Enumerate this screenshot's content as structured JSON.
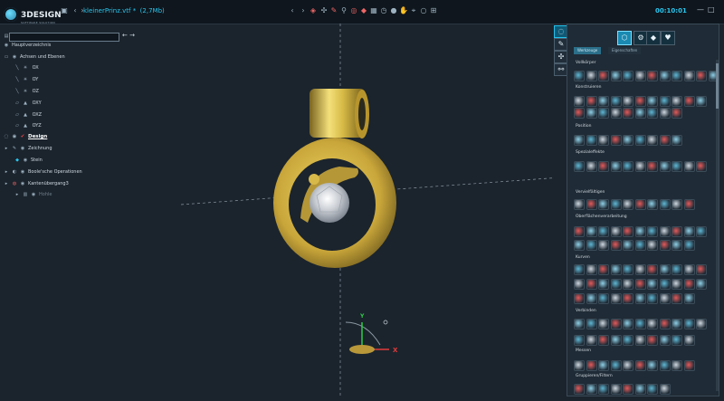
{
  "app": {
    "logo_text": "3DESIGN",
    "logo_sub": "SOFTWARE SOLUTION",
    "filename": "kleinerPrinz.vtf *",
    "filesize": "(2,7Mb)",
    "time": "00:10:01",
    "accent": "#28c7f0"
  },
  "toolbar": {
    "icons": [
      "back-icon",
      "forward-icon",
      "compass-icon",
      "view-icon",
      "brush-icon",
      "wand-icon",
      "ring-icon",
      "gem-icon",
      "cube-icon",
      "clock-icon",
      "sphere-icon",
      "hand-icon",
      "cursor-icon",
      "circle-icon",
      "box-icon",
      "eye-icon",
      "camera-icon"
    ]
  },
  "tree": {
    "nav_back": "←",
    "nav_forward": "→",
    "items": [
      {
        "label": "Hauptverzeichnis"
      },
      {
        "label": "Achsen und Ebenen"
      },
      {
        "label": "OX"
      },
      {
        "label": "OY"
      },
      {
        "label": "OZ"
      },
      {
        "label": "OXY"
      },
      {
        "label": "OXZ"
      },
      {
        "label": "OYZ"
      },
      {
        "label": "Design"
      },
      {
        "label": "Zeichnung"
      },
      {
        "label": "Stein"
      },
      {
        "label": "Boole'sche Operationen"
      },
      {
        "label": "Kantenübergang3"
      },
      {
        "label": "Hohle"
      }
    ]
  },
  "viewport": {
    "axes": {
      "x": "X",
      "y": "Y"
    }
  },
  "panel": {
    "tabs": [
      {
        "label": "Werkzeuge"
      },
      {
        "label": "Eigenschaften"
      }
    ],
    "sections": [
      {
        "label": "Vollkörper"
      },
      {
        "label": "Konstruieren"
      },
      {
        "label": "Position"
      },
      {
        "label": "Spezialeffekte"
      },
      {
        "label": "Vervielfältigen"
      },
      {
        "label": "Oberflächenverarbeitung"
      },
      {
        "label": "Kurven"
      },
      {
        "label": "Verbinden"
      },
      {
        "label": "Messen"
      },
      {
        "label": "Gruppieren/Filtern"
      }
    ]
  }
}
